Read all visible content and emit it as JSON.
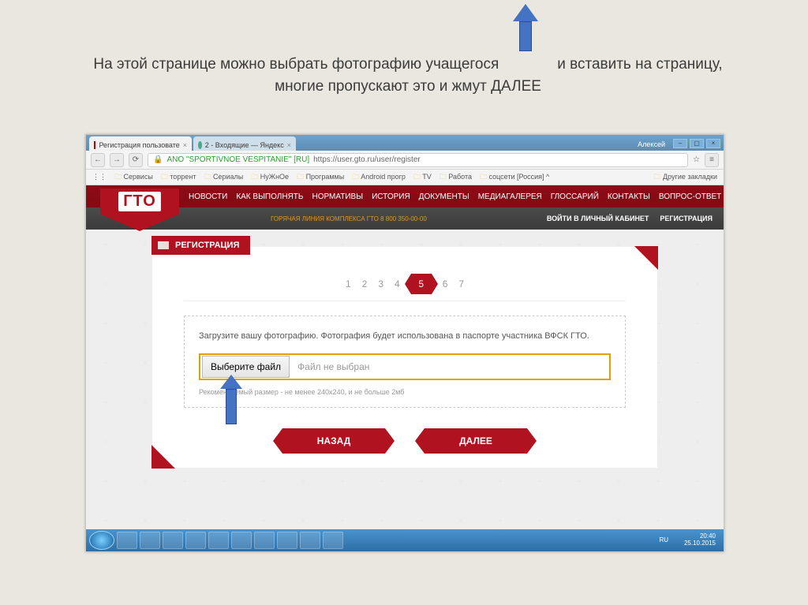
{
  "caption_line1_left": "На этой странице можно выбрать фотографию учащегося",
  "caption_line1_right": "и вставить на страницу,",
  "caption_line2": "многие пропускают это и жмут ДАЛЕЕ",
  "browser": {
    "tab1": "Регистрация пользовате",
    "tab2": "2 - Входящие — Яндекс",
    "user": "Алексей",
    "addr_security": "ANO \"SPORTIVNOE VESPITANIE\" [RU]",
    "addr_url": "https://user.gto.ru/user/register",
    "bookmarks": [
      "Сервисы",
      "торрент",
      "Сериалы",
      "НуЖнОе",
      "Программы",
      "Android прогр",
      "TV",
      "Работа",
      "соцсети [Россия] ^"
    ],
    "bookmarks_right": "Другие закладки"
  },
  "site": {
    "logo": "ГТО",
    "nav": [
      "НОВОСТИ",
      "КАК ВЫПОЛНЯТЬ",
      "НОРМАТИВЫ",
      "ИСТОРИЯ",
      "ДОКУМЕНТЫ",
      "МЕДИАГАЛЕРЕЯ",
      "ГЛОССАРИЙ",
      "КОНТАКТЫ",
      "ВОПРОС-ОТВЕТ"
    ],
    "hotline": "ГОРЯЧАЯ ЛИНИЯ КОМПЛЕКСА ГТО 8 800 350-00-00",
    "login": "ВОЙТИ В ЛИЧНЫЙ КАБИНЕТ",
    "register": "РЕГИСТРАЦИЯ"
  },
  "panel": {
    "title": "РЕГИСТРАЦИЯ",
    "steps": [
      "1",
      "2",
      "3",
      "4",
      "5",
      "6",
      "7"
    ],
    "active_step": "5",
    "instruction": "Загрузите вашу фотографию. Фотография будет использована в паспорте участника ВФСК ГТО.",
    "choose_file": "Выберите файл",
    "no_file": "Файл не выбран",
    "recommend": "Рекомендуемый размер - не менее 240x240, и не больше 2мб",
    "back": "НАЗАД",
    "next": "ДАЛЕЕ"
  },
  "tray": {
    "time": "20:40",
    "date": "25.10.2015",
    "lang": "RU"
  }
}
